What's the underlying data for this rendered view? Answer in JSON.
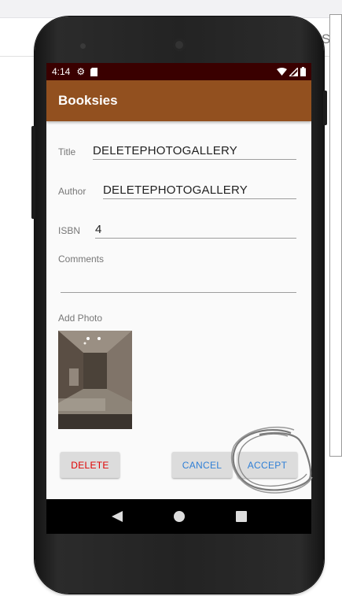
{
  "desktop": {
    "edge_text": "S"
  },
  "status_bar": {
    "time": "4:14"
  },
  "app_bar": {
    "title": "Booksies",
    "color": "#92501f",
    "status_color": "#3a0000"
  },
  "form": {
    "title": {
      "label": "Title",
      "value": "DELETEPHOTOGALLERY"
    },
    "author": {
      "label": "Author",
      "value": "DELETEPHOTOGALLERY"
    },
    "isbn": {
      "label": "ISBN",
      "value": "4"
    },
    "comments": {
      "label": "Comments",
      "value": ""
    },
    "photo": {
      "label": "Add Photo"
    }
  },
  "buttons": {
    "delete": "DELETE",
    "cancel": "CANCEL",
    "accept": "ACCEPT"
  },
  "nav_icons": [
    "back-icon",
    "home-icon",
    "recents-icon"
  ]
}
